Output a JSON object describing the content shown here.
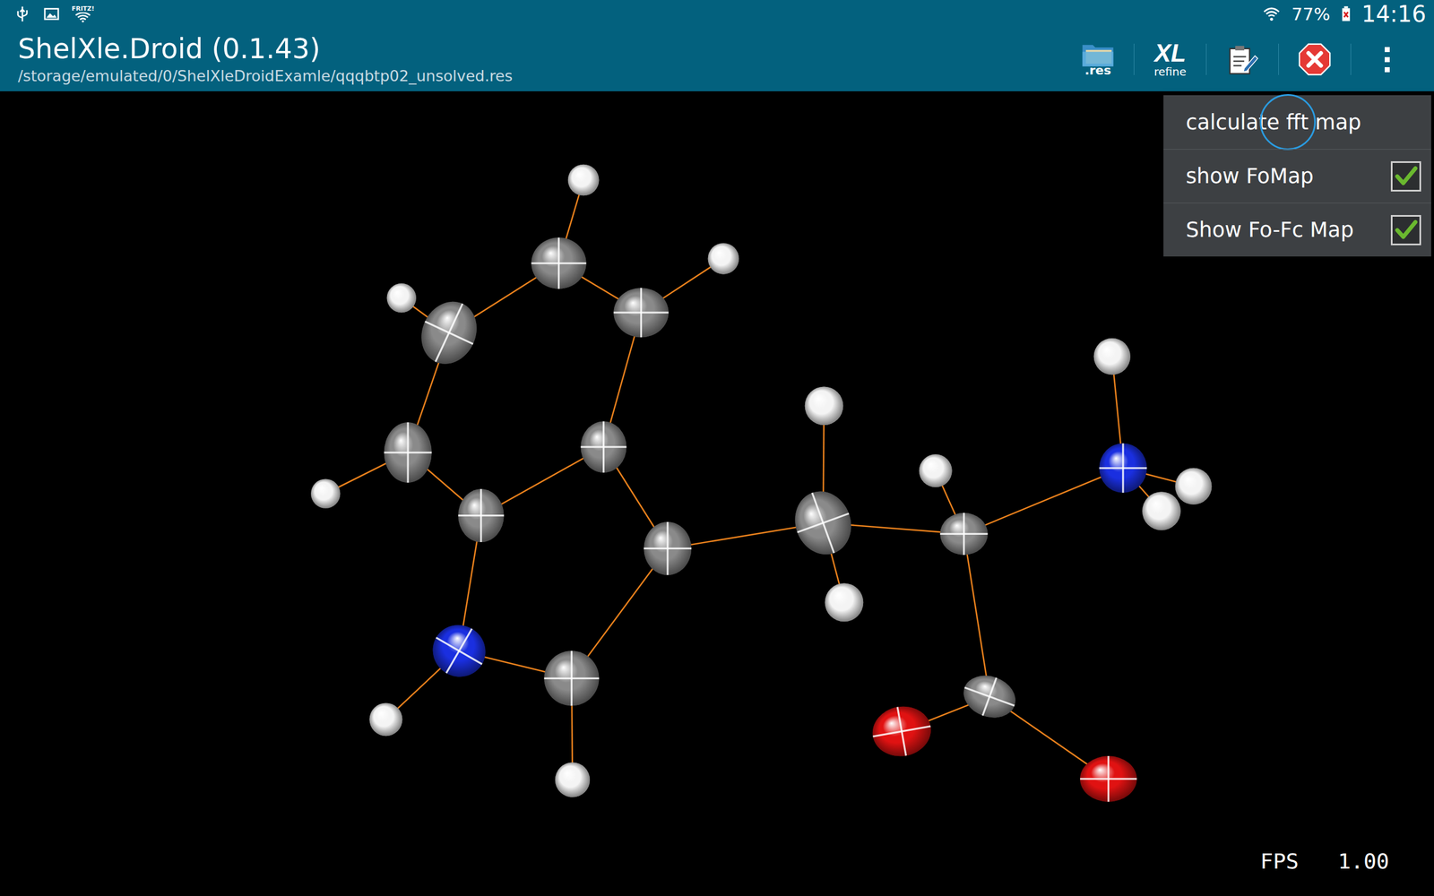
{
  "status_bar": {
    "wifi_label": "FRITZ!",
    "battery": "77%",
    "time": "14:16"
  },
  "app_bar": {
    "title": "ShelXle.Droid (0.1.43)",
    "subtitle": "/storage/emulated/0/ShelXleDroidExamle/qqqbtp02_unsolved.res",
    "actions": [
      {
        "kind": "open",
        "label": ".res"
      },
      {
        "kind": "refine",
        "label": "XL",
        "sublabel": "refine"
      },
      {
        "kind": "edit"
      },
      {
        "kind": "close"
      },
      {
        "kind": "overflow"
      }
    ]
  },
  "menu": {
    "items": [
      {
        "label": "calculate fft map",
        "kind": "action",
        "touched": true
      },
      {
        "label": "show FoMap",
        "kind": "checkbox",
        "checked": true,
        "touched": false
      },
      {
        "label": "Show Fo-Fc Map",
        "kind": "checkbox",
        "checked": true,
        "touched": false
      }
    ]
  },
  "viewer": {
    "atoms": [
      {
        "kind": "carbon",
        "color": "#8a8a8a"
      },
      {
        "kind": "carbon",
        "color": "#8a8a8a"
      },
      {
        "kind": "carbon",
        "color": "#8a8a8a"
      },
      {
        "kind": "carbon",
        "color": "#8a8a8a"
      },
      {
        "kind": "carbon",
        "color": "#8a8a8a"
      },
      {
        "kind": "carbon",
        "color": "#8a8a8a"
      },
      {
        "kind": "carbon",
        "color": "#8a8a8a"
      },
      {
        "kind": "carbon",
        "color": "#8a8a8a"
      },
      {
        "kind": "carbon",
        "color": "#8a8a8a"
      },
      {
        "kind": "carbon",
        "color": "#8a8a8a"
      },
      {
        "kind": "carbon",
        "color": "#8a8a8a"
      },
      {
        "kind": "nitrogen",
        "color": "#1a2fe0"
      },
      {
        "kind": "nitrogen",
        "color": "#1a2fe0"
      },
      {
        "kind": "oxygen",
        "color": "#e01212"
      },
      {
        "kind": "oxygen",
        "color": "#e01212"
      },
      {
        "kind": "hydrogen",
        "color": "#f4f4f4"
      },
      {
        "kind": "hydrogen",
        "color": "#f4f4f4"
      },
      {
        "kind": "hydrogen",
        "color": "#f4f4f4"
      },
      {
        "kind": "hydrogen",
        "color": "#f4f4f4"
      },
      {
        "kind": "hydrogen",
        "color": "#f4f4f4"
      },
      {
        "kind": "hydrogen",
        "color": "#f4f4f4"
      },
      {
        "kind": "hydrogen",
        "color": "#f4f4f4"
      },
      {
        "kind": "hydrogen",
        "color": "#f4f4f4"
      },
      {
        "kind": "hydrogen",
        "color": "#f4f4f4"
      },
      {
        "kind": "hydrogen",
        "color": "#f4f4f4"
      },
      {
        "kind": "hydrogen",
        "color": "#f4f4f4"
      },
      {
        "kind": "hydrogen",
        "color": "#f4f4f4"
      }
    ]
  },
  "fps": {
    "label": "FPS",
    "value": "1.00"
  }
}
